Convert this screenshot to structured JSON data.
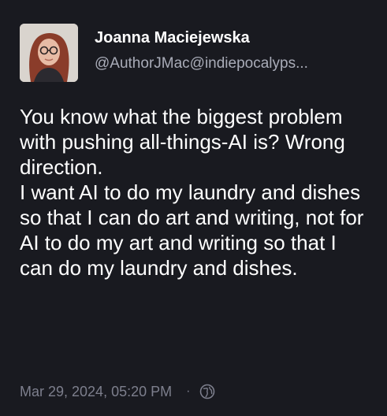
{
  "author": {
    "display_name": "Joanna Maciejewska",
    "handle": "@AuthorJMac@indiepocalyps..."
  },
  "post": {
    "paragraphs": [
      "You know what the biggest problem with pushing all-things-AI is? Wrong direction.",
      "I want AI to do my laundry and dishes so that I can do art and writing, not for AI to do my art and writing so that I can do my laundry and dishes."
    ],
    "timestamp": "Mar 29, 2024, 05:20 PM",
    "separator": "·",
    "visibility_icon": "globe-icon"
  },
  "colors": {
    "background": "#191a20",
    "text": "#ffffff",
    "handle": "#a9acb8",
    "meta": "#7d7f8d"
  }
}
